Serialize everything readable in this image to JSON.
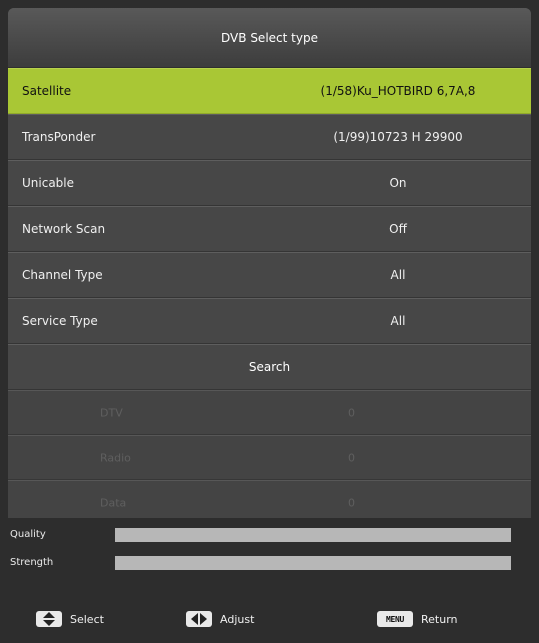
{
  "window": {
    "title": "DVB Select type"
  },
  "settings": [
    {
      "label": "Satellite",
      "value": "(1/58)Ku_HOTBIRD 6,7A,8",
      "selected": true
    },
    {
      "label": "TransPonder",
      "value": "(1/99)10723 H 29900",
      "selected": false
    },
    {
      "label": "Unicable",
      "value": "On",
      "selected": false
    },
    {
      "label": "Network Scan",
      "value": "Off",
      "selected": false
    },
    {
      "label": "Channel Type",
      "value": "All",
      "selected": false
    },
    {
      "label": "Service Type",
      "value": "All",
      "selected": false
    }
  ],
  "search": {
    "label": "Search"
  },
  "results": [
    {
      "label": "DTV",
      "value": "0"
    },
    {
      "label": "Radio",
      "value": "0"
    },
    {
      "label": "Data",
      "value": "0"
    }
  ],
  "meters": {
    "quality": {
      "label": "Quality",
      "level": 1.0
    },
    "strength": {
      "label": "Strength",
      "level": 1.0
    }
  },
  "footer": {
    "select": {
      "icon": "up-down-arrow-icon",
      "label": "Select"
    },
    "adjust": {
      "icon": "left-right-arrow-icon",
      "label": "Adjust"
    },
    "return": {
      "icon": "menu-key-icon",
      "key_text": "MENU",
      "label": "Return"
    }
  },
  "colors": {
    "highlight": "#a9c735",
    "panel": "#474747",
    "background": "#2d2d2d"
  }
}
